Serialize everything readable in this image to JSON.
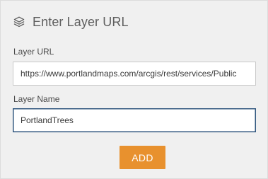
{
  "header": {
    "icon": "layers-icon",
    "title": "Enter Layer URL"
  },
  "form": {
    "url_label": "Layer URL",
    "url_value": "https://www.portlandmaps.com/arcgis/rest/services/Public",
    "name_label": "Layer Name",
    "name_value": "PortlandTrees"
  },
  "actions": {
    "add_label": "ADD"
  },
  "colors": {
    "panel_bg": "#f0f0f0",
    "accent_button": "#e8912e",
    "focused_border": "#31577f"
  }
}
